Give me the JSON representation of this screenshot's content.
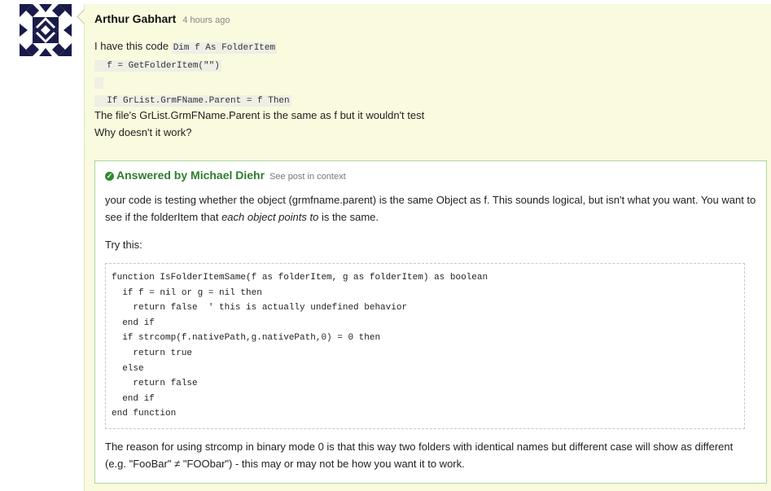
{
  "question": {
    "author": "Arthur Gabhart",
    "time": "4 hours ago",
    "intro": "I have this code",
    "code_line1": "Dim f As FolderItem",
    "code_line2": "  f = GetFolderItem(\"\")",
    "code_line3": " ",
    "code_line4": "  If GrList.GrmFName.Parent = f Then",
    "text1": "The file's GrList.GrmFName.Parent is the same as f but it wouldn't test",
    "text2": "Why doesn't it work?"
  },
  "answer": {
    "label": "Answered by Michael Diehr",
    "context_link": "See post in context",
    "p1_before": "your code is testing whether the object (grmfname.parent) is the same Object as f. This sounds logical, but isn't what you want. You want to see if the folderItem that ",
    "p1_em": "each object points to",
    "p1_after": " is the same.",
    "try_this": "Try this:",
    "code": [
      "function IsFolderItemSame(f as folderItem, g as folderItem) as boolean",
      "  if f = nil or g = nil then",
      "    return false  ' this is actually undefined behavior",
      "  end if",
      "  if strcomp(f.nativePath,g.nativePath,0) = 0 then",
      "    return true",
      "  else",
      "    return false",
      "  end if",
      "end function"
    ],
    "closing": "The reason for using strcomp in binary mode 0 is that this way two folders with identical names but different case will show as different (e.g. \"FooBar\" ≠ \"FOObar\") - this may or may not be how you want it to work."
  },
  "icons": {
    "avatar": "identicon-avatar",
    "answered": "check-circle-icon"
  },
  "colors": {
    "post_background": "#fafade",
    "answer_border": "#a8d8a0",
    "answer_accent": "#2e7d2e",
    "avatar_color": "#1a1a4a"
  }
}
